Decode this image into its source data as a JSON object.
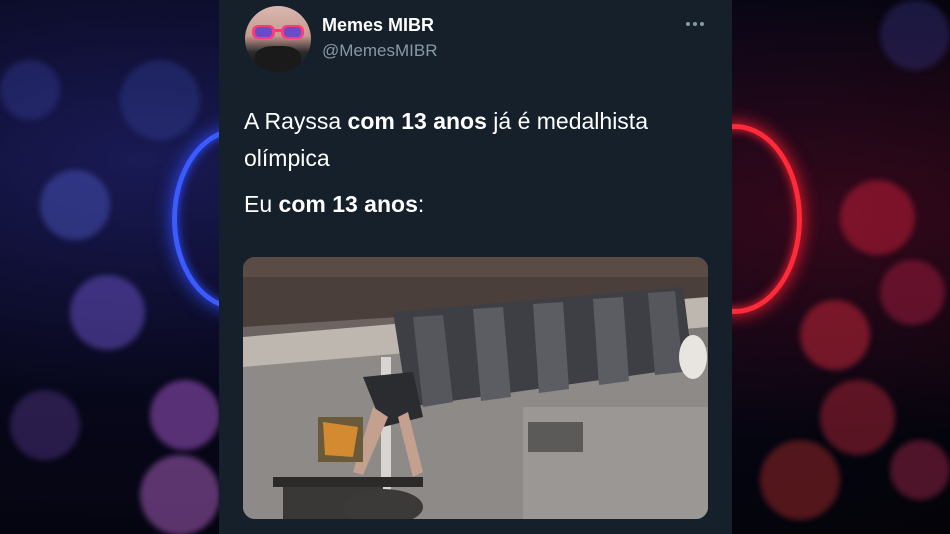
{
  "tweet": {
    "display_name": "Memes MIBR",
    "handle": "@MemesMIBR",
    "menu_icon": "more-horizontal-icon",
    "text_line1_part1": "A Rayssa ",
    "text_line1_bold": "com 13 anos",
    "text_line1_part2": " já é medalhista olímpica",
    "text_line2_part1": "Eu ",
    "text_line2_bold": "com 13 anos",
    "text_line2_part2": ":",
    "media_description_icon": "photo-icon"
  },
  "colors": {
    "card_background": "#15202b",
    "primary_text": "#ffffff",
    "secondary_text": "#8899a6",
    "ring_left": "#3b5bff",
    "ring_right": "#ff2a3a"
  }
}
